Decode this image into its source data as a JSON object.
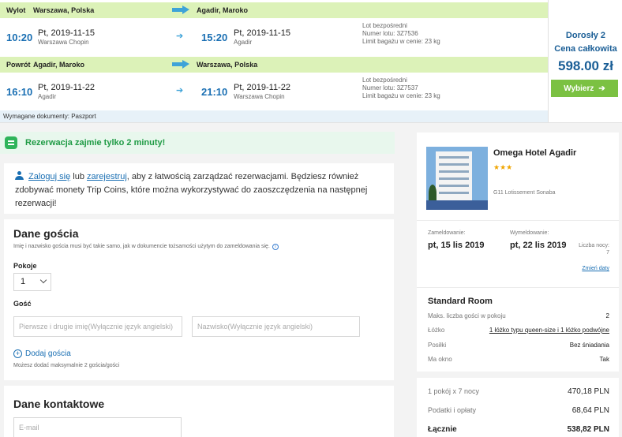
{
  "outbound": {
    "label": "Wylot",
    "from": "Warszawa, Polska",
    "to": "Agadir, Maroko",
    "depart_time": "10:20",
    "depart_date": "Pt, 2019-11-15",
    "depart_airport": "Warszawa Chopin",
    "arrive_time": "15:20",
    "arrive_date": "Pt, 2019-11-15",
    "arrive_airport": "Agadir",
    "info1": "Lot bezpośredni",
    "info2": "Numer lotu: 3Z7536",
    "info3": "Limit bagażu w cenie: 23 kg"
  },
  "return": {
    "label": "Powrót",
    "from": "Agadir, Maroko",
    "to": "Warszawa, Polska",
    "depart_time": "16:10",
    "depart_date": "Pt, 2019-11-22",
    "depart_airport": "Agadir",
    "arrive_time": "21:10",
    "arrive_date": "Pt, 2019-11-22",
    "arrive_airport": "Warszawa Chopin",
    "info1": "Lot bezpośredni",
    "info2": "Numer lotu: 3Z7537",
    "info3": "Limit bagażu w cenie: 23 kg"
  },
  "docs": "Wymagane dokumenty: Paszport",
  "price": {
    "passengers": "Dorosły 2",
    "total_label": "Cena całkowita",
    "amount": "598.00 zł",
    "select_button": "Wybierz"
  },
  "notice": "Rezerwacja zajmie tylko 2 minuty!",
  "login": {
    "login_link": "Zaloguj się",
    "or": "lub",
    "register_link": "zarejestruj",
    "text": ", aby z łatwością zarządzać rezerwacjami. Będziesz również zdobywać monety Trip Coins, które można wykorzystywać do zaoszczędzenia na następnej rezerwacji!"
  },
  "guest_section": {
    "title": "Dane gościa",
    "subtitle": "Imię i nazwisko gościa musi być takie samo, jak w dokumencie tożsamości użytym do zameldowania się.",
    "rooms_label": "Pokoje",
    "rooms_value": "1",
    "guest_label": "Gość",
    "first_name_placeholder": "Pierwsze i drugie imię(Wyłącznie język angielski)",
    "last_name_placeholder": "Nazwisko(Wyłącznie język angielski)",
    "add_guest": "Dodaj gościa",
    "max_guests": "Możesz dodać maksymalnie 2 gościa/gości"
  },
  "contact_section": {
    "title": "Dane kontaktowe",
    "email_placeholder": "E-mail"
  },
  "hotel": {
    "name": "Omega Hotel Agadir",
    "stars": "★★★",
    "address": "G11 Lotissement Sonaba",
    "checkin_label": "Zameldowanie:",
    "checkin_value": "pt, 15 lis 2019",
    "checkout_label": "Wymeldowanie:",
    "checkout_value": "pt, 22 lis 2019",
    "nights_label": "Liczba nocy:",
    "nights_value": "7",
    "change_dates": "Zmień daty",
    "room_type": "Standard Room",
    "rows": [
      {
        "label": "Maks. liczba gości w pokoju",
        "value": "2"
      },
      {
        "label": "Łóżko",
        "value": "1 łóżko typu queen-size i 1 łóżko podwójne"
      },
      {
        "label": "Posiłki",
        "value": "Bez śniadania"
      },
      {
        "label": "Ma okno",
        "value": "Tak"
      }
    ]
  },
  "summary": {
    "rows": [
      {
        "label": "1 pokój x 7 nocy",
        "value": "470,18 PLN"
      },
      {
        "label": "Podatki i opłaty",
        "value": "68,64 PLN"
      }
    ],
    "total_label": "Łącznie",
    "total_value": "538,82 PLN"
  }
}
